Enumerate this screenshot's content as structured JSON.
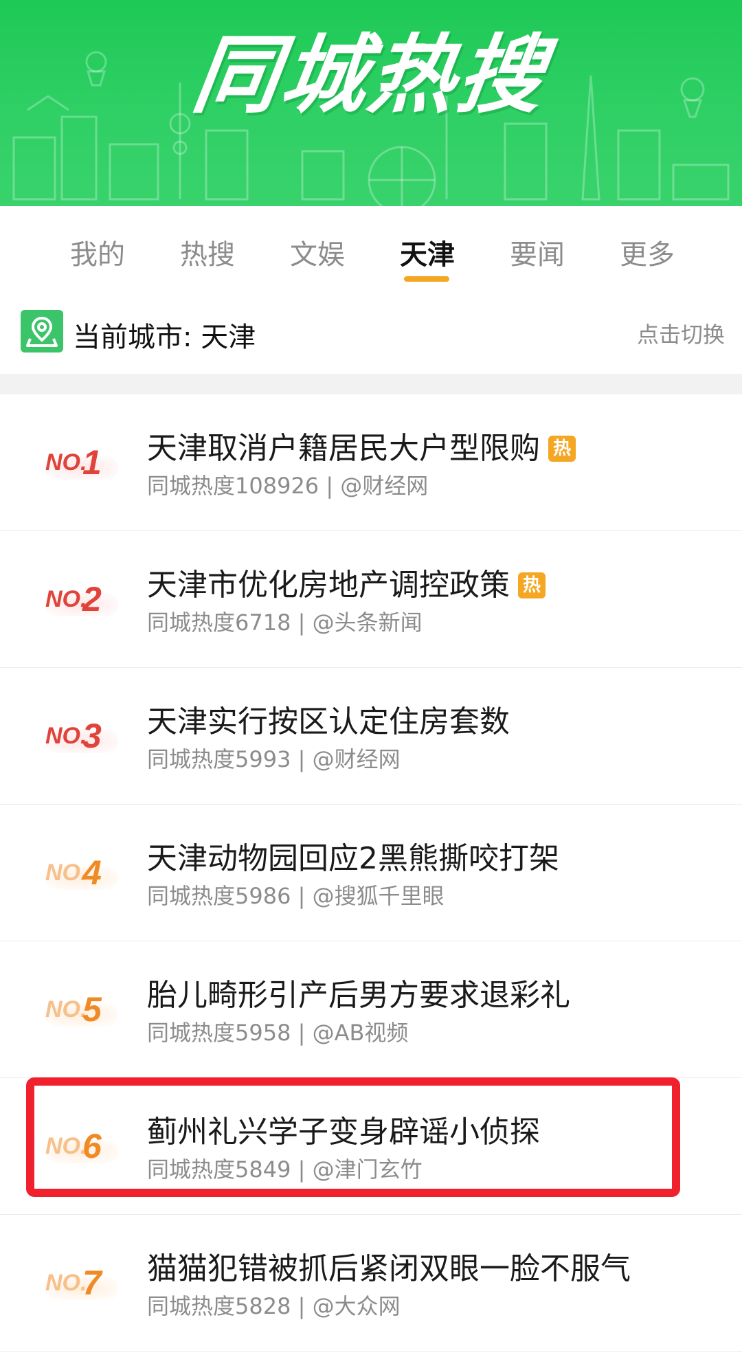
{
  "banner": {
    "title": "同城热搜"
  },
  "tabs": [
    "我的",
    "热搜",
    "文娱",
    "天津",
    "要闻",
    "更多"
  ],
  "active_tab": "天津",
  "city": {
    "label": "当前城市: 天津",
    "switch_label": "点击切换"
  },
  "items": [
    {
      "rank_prefix": "NO.",
      "rank": "1",
      "title": "天津取消户籍居民大户型限购",
      "hot": "热",
      "meta": "同城热度108926 | @财经网",
      "rank_color": "#e0433a"
    },
    {
      "rank_prefix": "NO.",
      "rank": "2",
      "title": "天津市优化房地产调控政策",
      "hot": "热",
      "meta": "同城热度6718 | @头条新闻",
      "rank_color": "#e0433a"
    },
    {
      "rank_prefix": "NO.",
      "rank": "3",
      "title": "天津实行按区认定住房套数",
      "hot": "",
      "meta": "同城热度5993 | @财经网",
      "rank_color": "#e0433a"
    },
    {
      "rank_prefix": "NO.",
      "rank": "4",
      "title": "天津动物园回应2黑熊撕咬打架",
      "hot": "",
      "meta": "同城热度5986 | @搜狐千里眼",
      "rank_color": "#f08a24"
    },
    {
      "rank_prefix": "NO.",
      "rank": "5",
      "title": "胎儿畸形引产后男方要求退彩礼",
      "hot": "",
      "meta": "同城热度5958 | @AB视频",
      "rank_color": "#f08a24"
    },
    {
      "rank_prefix": "NO.",
      "rank": "6",
      "title": "蓟州礼兴学子变身辟谣小侦探",
      "hot": "",
      "meta": "同城热度5849 | @津门玄竹",
      "rank_color": "#f08a24"
    },
    {
      "rank_prefix": "NO.",
      "rank": "7",
      "title": "猫猫犯错被抓后紧闭双眼一脸不服气",
      "hot": "",
      "meta": "同城热度5828 | @大众网",
      "rank_color": "#f08a24"
    }
  ],
  "colors": {
    "brand_green": "#2fd065",
    "accent_orange": "#f5a623",
    "highlight_red": "#f0202c"
  }
}
